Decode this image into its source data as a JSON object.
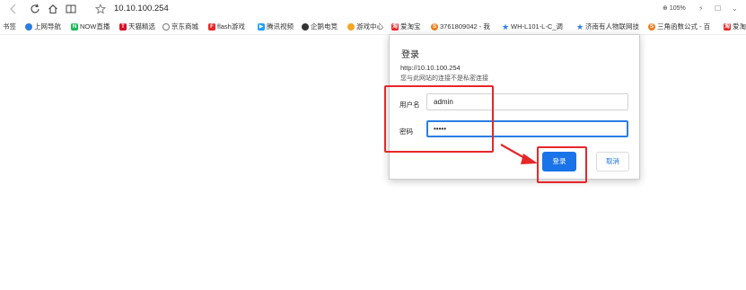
{
  "browser": {
    "url": "10.10.100.254",
    "zoom": "105%",
    "icons": [
      "back-icon",
      "refresh-icon",
      "home-icon",
      "reader-icon",
      "star-icon"
    ]
  },
  "bookmarks": [
    {
      "label": "书签",
      "icon": "",
      "color": ""
    },
    {
      "label": "上网导航",
      "icon": "nav-icon",
      "color": "#2b7de3"
    },
    {
      "label": "NOW直播",
      "icon": "now-icon",
      "color": "#1fb85a"
    },
    {
      "label": "天猫精选",
      "icon": "tmall-icon",
      "color": "#d3102a"
    },
    {
      "label": "京东商城",
      "icon": "globe-icon",
      "color": "#777777"
    },
    {
      "label": "flash游戏",
      "icon": "flash-icon",
      "color": "#e8262a"
    },
    {
      "label": "腾讯视频",
      "icon": "video-icon",
      "color": "#19a0ff"
    },
    {
      "label": "企鹅电竞",
      "icon": "penguin-icon",
      "color": "#333333"
    },
    {
      "label": "游戏中心",
      "icon": "game-icon",
      "color": "#f5a623"
    },
    {
      "label": "爱淘宝",
      "icon": "taobao-icon",
      "color": "#e8262a"
    },
    {
      "label": "3761809042 - 我",
      "icon": "s-icon",
      "color": "#f07c1f"
    },
    {
      "label": "WH-L101-L-C_调",
      "icon": "person-icon",
      "color": "#2b7de3"
    },
    {
      "label": "济南有人物联网技",
      "icon": "person-icon",
      "color": "#2b7de3"
    },
    {
      "label": "三角函数公式 - 百",
      "icon": "s-icon",
      "color": "#f07c1f"
    },
    {
      "label": "爱淘",
      "icon": "taobao-icon",
      "color": "#e8262a"
    }
  ],
  "dialog": {
    "title": "登录",
    "host": "http://10.10.100.254",
    "note": "您与此网站的连接不是私密连接",
    "username_label": "用户名",
    "username_value": "admin",
    "password_label": "密码",
    "password_value": "•••••",
    "login_button": "登录",
    "cancel_button": "取消"
  },
  "colors": {
    "accent": "#1a73e8",
    "annotation": "#e8262a"
  }
}
